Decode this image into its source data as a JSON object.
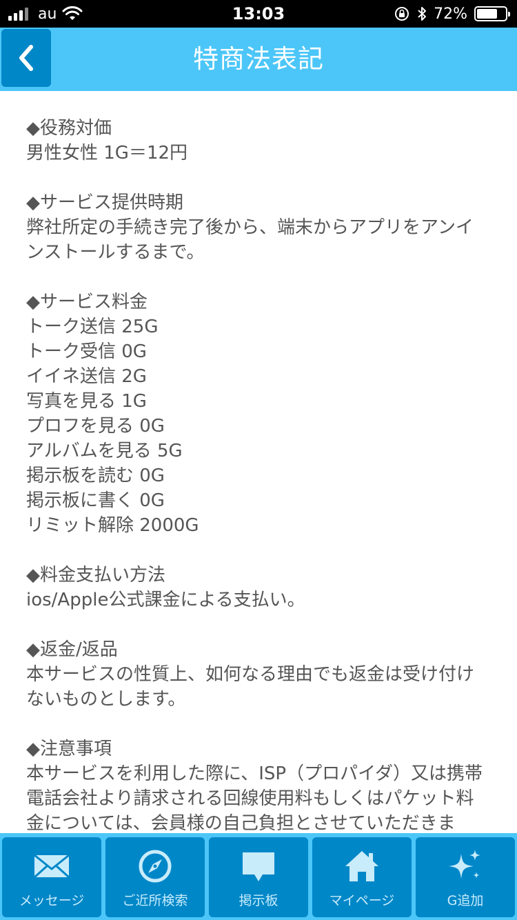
{
  "status_bar": {
    "carrier": "au",
    "time": "13:03",
    "battery": "72%",
    "battery_level": 0.72
  },
  "header": {
    "title": "特商法表記",
    "back_icon": "chevron-left-icon"
  },
  "sections": [
    {
      "heading": "◆役務対価",
      "lines": [
        "男性女性 1G＝12円"
      ]
    },
    {
      "heading": "◆サービス提供時期",
      "lines": [
        "弊社所定の手続き完了後から、端末からアプリをアンインストールするまで。"
      ]
    },
    {
      "heading": "◆サービス料金",
      "lines": [
        "トーク送信 25G",
        "トーク受信 0G",
        "イイネ送信 2G",
        "写真を見る 1G",
        "プロフを見る 0G",
        "アルバムを見る 5G",
        "掲示板を読む 0G",
        "掲示板に書く 0G",
        "リミット解除 2000G"
      ]
    },
    {
      "heading": "◆料金支払い方法",
      "lines": [
        "ios/Apple公式課金による支払い。"
      ]
    },
    {
      "heading": "◆返金/返品",
      "lines": [
        "本サービスの性質上、如何なる理由でも返金は受け付けないものとします。"
      ]
    },
    {
      "heading": "◆注意事項",
      "lines": [
        "本サービスを利用した際に、ISP（プロパイダ）又は携帯電話会社より請求される回線使用料もしくはパケット料金については、会員様の自己負担とさせていただきま"
      ]
    }
  ],
  "tab_bar": {
    "items": [
      {
        "label": "メッセージ",
        "icon": "mail-icon"
      },
      {
        "label": "ご近所検索",
        "icon": "compass-icon"
      },
      {
        "label": "掲示板",
        "icon": "chat-bubble-icon"
      },
      {
        "label": "マイページ",
        "icon": "home-icon"
      },
      {
        "label": "G追加",
        "icon": "sparkle-icon"
      }
    ]
  },
  "colors": {
    "header_bg": "#4cc6f8",
    "button_bg": "#0087c8",
    "text": "#555555"
  }
}
